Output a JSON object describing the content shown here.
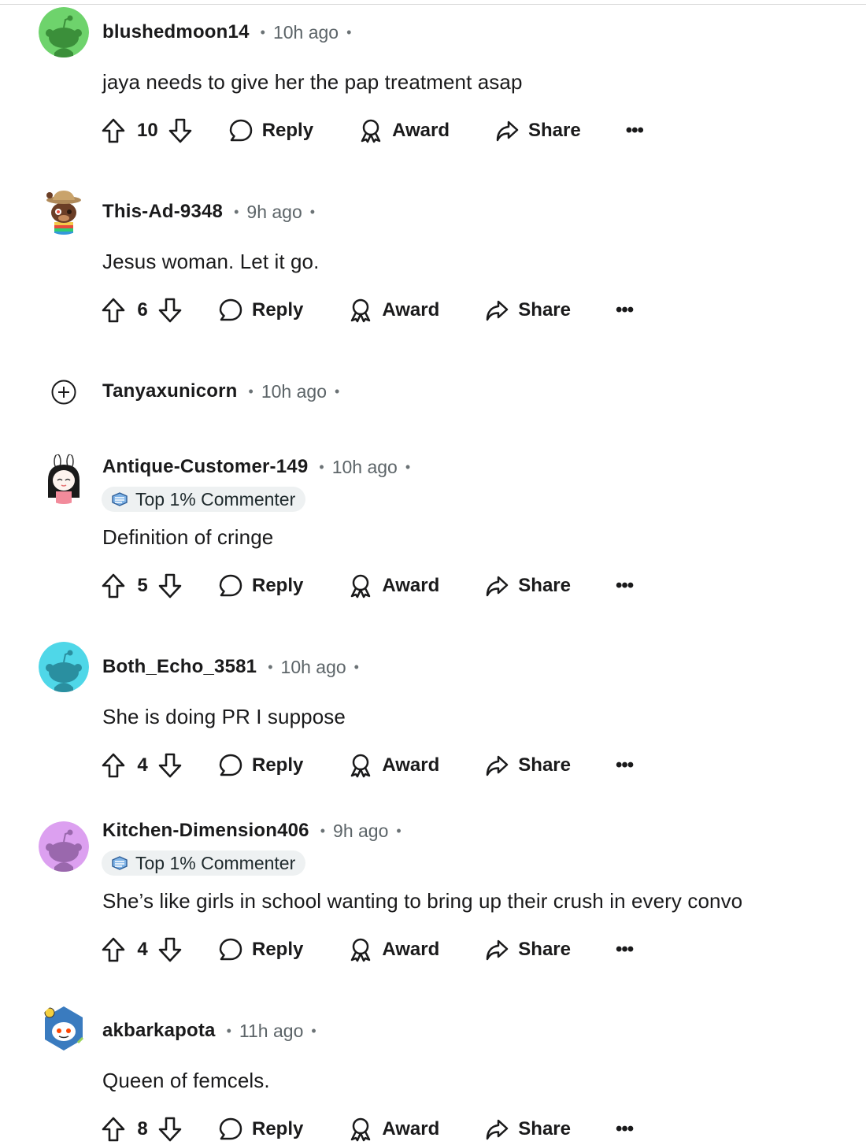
{
  "labels": {
    "reply": "Reply",
    "award": "Award",
    "share": "Share",
    "more": "•••",
    "dot": "•"
  },
  "flair_text": "Top 1% Commenter",
  "colors": {
    "green": "#6ed36c",
    "cyan": "#4fd7e8",
    "purple": "#dca0f0"
  },
  "comments": [
    {
      "username": "blushedmoon14",
      "time": "10h ago",
      "body": "jaya needs to give her the pap treatment asap",
      "score": "10",
      "avatar": "snoo-green"
    },
    {
      "username": "This-Ad-9348",
      "time": "9h ago",
      "body": "Jesus woman. Let it go.",
      "score": "6",
      "avatar": "snoo-bear-hat"
    },
    {
      "username": "Tanyaxunicorn",
      "time": "10h ago",
      "collapsed": true,
      "avatar": "expand-plus-icon"
    },
    {
      "username": "Antique-Customer-149",
      "time": "10h ago",
      "flair": "Top 1% Commenter",
      "body": "Definition of cringe",
      "score": "5",
      "avatar": "snoo-bunny-girl"
    },
    {
      "username": "Both_Echo_3581",
      "time": "10h ago",
      "body": "She is doing PR I suppose",
      "score": "4",
      "avatar": "snoo-cyan"
    },
    {
      "username": "Kitchen-Dimension406",
      "time": "9h ago",
      "flair": "Top 1% Commenter",
      "body": "She’s like girls in school wanting to bring up their crush in every convo",
      "score": "4",
      "avatar": "snoo-purple"
    },
    {
      "username": "akbarkapota",
      "time": "11h ago",
      "body": "Queen of femcels.",
      "score": "8",
      "avatar": "snoo-astronaut"
    }
  ]
}
